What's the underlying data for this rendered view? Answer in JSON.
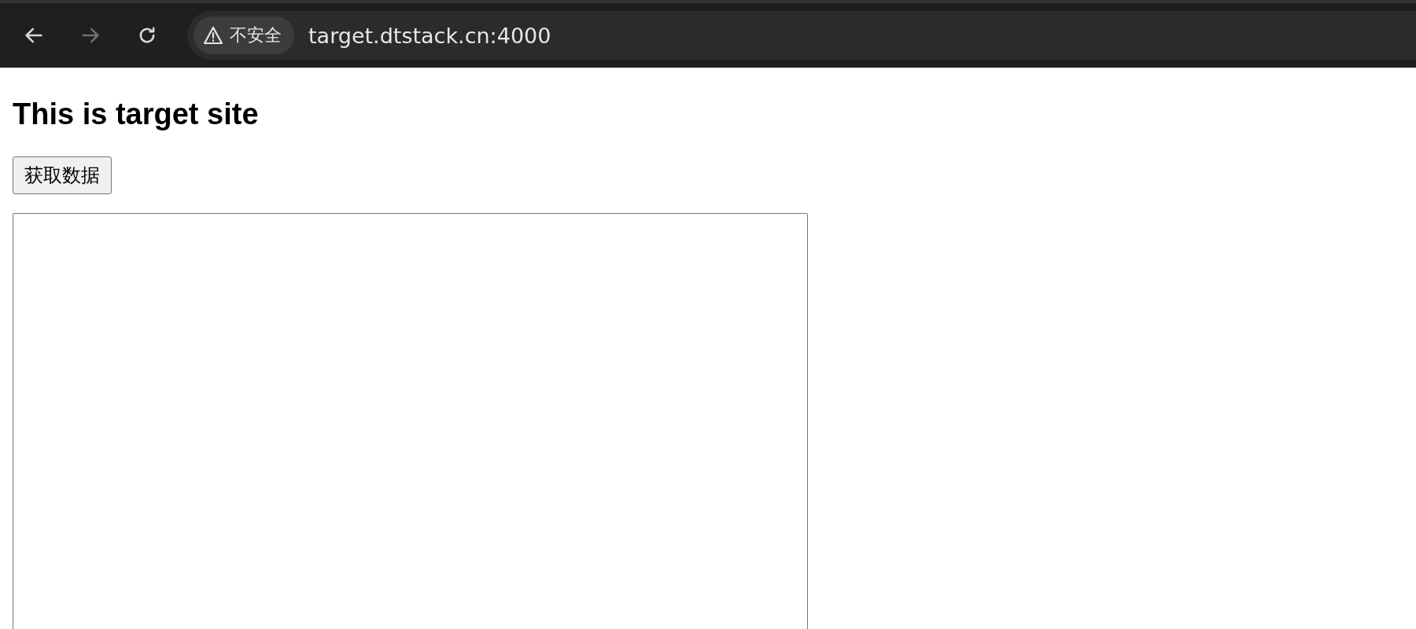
{
  "browser": {
    "nav_buttons": [
      {
        "kind": "back",
        "disabled": false
      },
      {
        "kind": "forward",
        "disabled": true
      },
      {
        "kind": "reload",
        "disabled": false
      }
    ],
    "security_chip": "不安全",
    "url": "target.dtstack.cn:4000"
  },
  "page": {
    "heading": "This is target site",
    "button": "获取数据"
  }
}
